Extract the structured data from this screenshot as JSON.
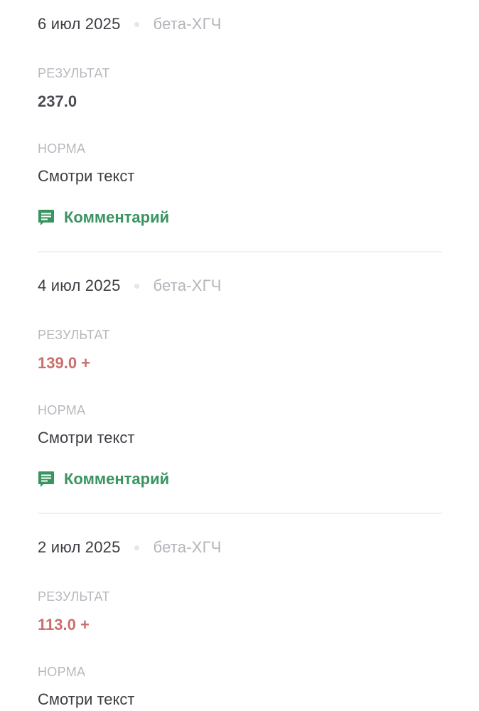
{
  "labels": {
    "result": "РЕЗУЛЬТАТ",
    "norm": "НОРМА",
    "comment": "Комментарий"
  },
  "entries": [
    {
      "date": "6 июл 2025",
      "test": "бета-ХГЧ",
      "result": "237.0",
      "result_status": "normal",
      "norm": "Смотри текст",
      "has_comment": true
    },
    {
      "date": "4 июл 2025",
      "test": "бета-ХГЧ",
      "result": "139.0 +",
      "result_status": "high",
      "norm": "Смотри текст",
      "has_comment": true
    },
    {
      "date": "2 июл 2025",
      "test": "бета-ХГЧ",
      "result": "113.0 +",
      "result_status": "high",
      "norm": "Смотри текст",
      "has_comment": false
    }
  ],
  "colors": {
    "accent_green": "#3a9461",
    "result_high": "#cc6e6e",
    "result_normal": "#4b4b52"
  },
  "icons": {
    "comment": "comment-icon"
  }
}
